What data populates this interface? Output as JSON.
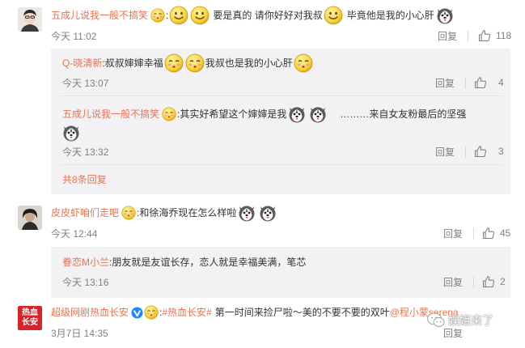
{
  "comments": [
    {
      "user": "五成儿说我一般不搞笑",
      "text_a": "要是真的 请你好好对我叔",
      "text_b": "毕竟他是我的小心肝",
      "time": "今天 11:02",
      "reply_label": "回复",
      "likes": "118"
    },
    {
      "user": "皮皮虾咱们走吧",
      "text_a": ":和徐海乔现在怎么样啦",
      "time": "今天 12:44",
      "reply_label": "回复",
      "likes": "45"
    },
    {
      "user": "超级网剧热血长安",
      "tag": "#热血长安#",
      "text_a": "第一时间来捡尸啦～美的不要不要的双叶",
      "mention": "@程小蒙serena",
      "time": "3月7日 14:35",
      "reply_label": "回复"
    }
  ],
  "replies_group1": [
    {
      "user": "Q-晓清新",
      "text_a": ":叔叔婶婶幸福",
      "text_b": "我叔也是我的小心肝",
      "time": "今天 13:07",
      "reply_label": "回复",
      "likes": "4"
    },
    {
      "user": "五成儿说我一般不搞笑",
      "text_a": ":其实好希望这个婶婶是我",
      "text_b": "………来自女友粉最后的坚强",
      "time": "今天 13:32",
      "reply_label": "回复",
      "likes": "3"
    }
  ],
  "more_replies": "共8条回复",
  "replies_group2": [
    {
      "user": "眷恋M小兰",
      "text_a": ":朋友就是友谊长存，恋人就是幸福美满，笔芯",
      "time": "今天 13:16",
      "reply_label": "回复",
      "likes": "2"
    }
  ],
  "avatar_badge_text": "热血长安",
  "watermark": "娱姐来了",
  "colors": {
    "accent": "#eb7350",
    "muted": "#808080",
    "reply_bg": "#f2f2f5"
  }
}
